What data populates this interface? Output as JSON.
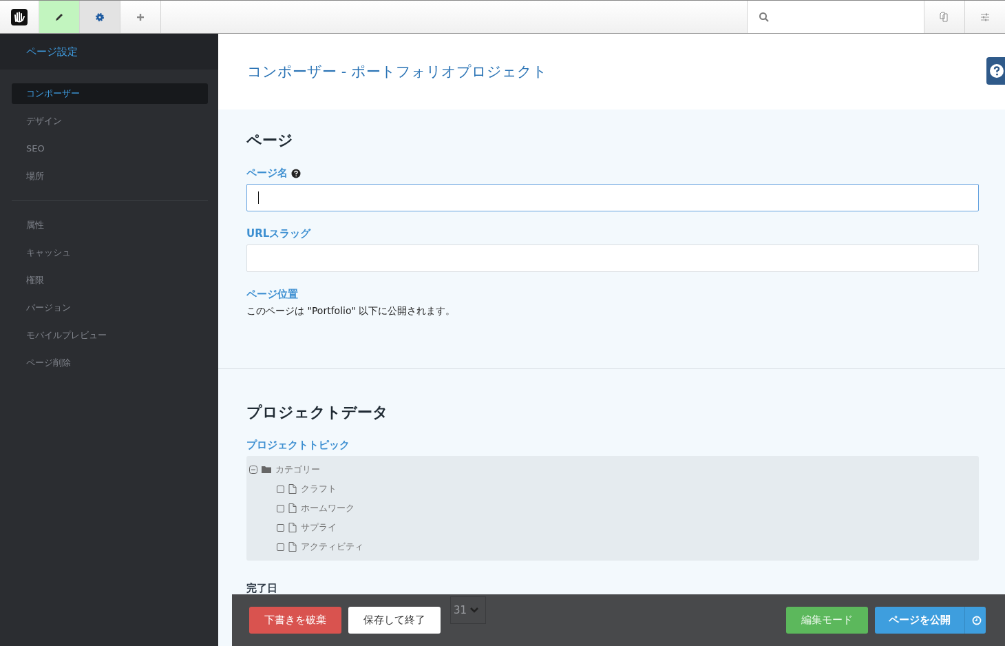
{
  "toolbar": {
    "left": [
      {
        "kind": "edit",
        "selected": true,
        "expanded": false
      },
      {
        "kind": "settings",
        "selected": false,
        "expanded": true
      },
      {
        "kind": "add",
        "selected": false,
        "expanded": false
      }
    ],
    "right": [
      {
        "kind": "pages"
      },
      {
        "kind": "options"
      }
    ]
  },
  "sidebar": {
    "title": "ページ設定",
    "groups": [
      [
        {
          "label": "コンポーザー",
          "selected": true
        },
        {
          "label": "デザイン",
          "selected": false
        },
        {
          "label": "SEO",
          "selected": false
        },
        {
          "label": "場所",
          "selected": false
        }
      ],
      [
        {
          "label": "属性",
          "selected": false
        },
        {
          "label": "キャッシュ",
          "selected": false
        },
        {
          "label": "権限",
          "selected": false
        },
        {
          "label": "バージョン",
          "selected": false
        },
        {
          "label": "モバイルプレビュー",
          "selected": false
        },
        {
          "label": "ページ削除",
          "selected": false
        }
      ]
    ]
  },
  "main": {
    "title": "コンポーザー - ポートフォリオプロジェクト",
    "sections": [
      {
        "heading": "ページ",
        "fields": [
          {
            "kind": "text",
            "label": "ページ名",
            "help": true,
            "focused": true
          },
          {
            "kind": "text",
            "label": "URLスラッグ",
            "help": false,
            "focused": false
          },
          {
            "kind": "note",
            "label": "ページ位置",
            "text": "このページは \"Portfolio\" 以下に公開されます。"
          }
        ]
      },
      {
        "heading": "プロジェクトデータ",
        "fields": [
          {
            "kind": "tree",
            "label": "プロジェクトトピック",
            "tree": [
              {
                "label": "カテゴリー",
                "expanded": true,
                "children": [
                  {
                    "label": "クラフト",
                    "checked": false
                  },
                  {
                    "label": "ホームワーク",
                    "checked": false
                  },
                  {
                    "label": "サプライ",
                    "checked": false
                  },
                  {
                    "label": "アクティビティ",
                    "checked": false
                  }
                ]
              }
            ]
          },
          {
            "kind": "date",
            "label": "完了日",
            "value": "31"
          }
        ]
      }
    ]
  },
  "footer": {
    "buttons": [
      {
        "kind": "danger",
        "label": "下書きを破棄"
      },
      {
        "kind": "plain",
        "label": "保存して終了"
      },
      {
        "kind": "success",
        "label": "編集モード"
      },
      {
        "kind": "primary",
        "label": "ページを公開"
      }
    ]
  }
}
